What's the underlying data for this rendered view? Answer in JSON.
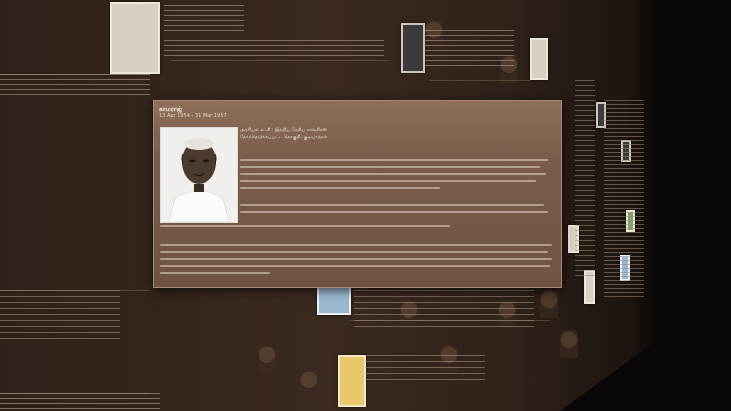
{
  "popup": {
    "title": "காமராஜ்",
    "dates": "13 Apr 1954 - 31 Mar 1957",
    "party_line": "அரசியல் கட்சி : இந்திய தேசிய காங்கிரஸ்",
    "constituency_line": "தேர்ந்தெடுக்கப்பட்ட தொகுதி: குடியாத்தம்"
  },
  "colors": {
    "wall": "#3a2a20",
    "popup_bg": "#7a5e4b",
    "text": "#f4e7dc"
  }
}
